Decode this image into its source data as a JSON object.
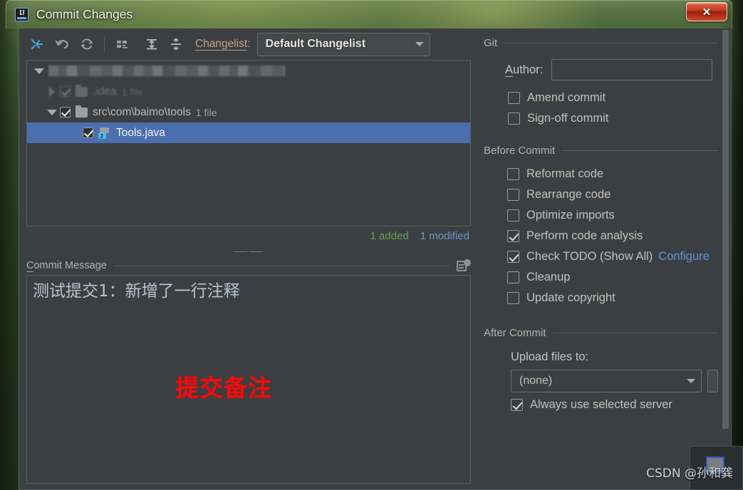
{
  "window": {
    "title": "Commit Changes",
    "app_icon": "intellij-idea-icon",
    "close_label": "✕"
  },
  "toolbar": {
    "buttons": [
      {
        "name": "show-diff-icon",
        "tooltip": "Show Diff"
      },
      {
        "name": "rollback-icon",
        "tooltip": "Rollback"
      },
      {
        "name": "refresh-icon",
        "tooltip": "Refresh"
      },
      {
        "name": "group-by-icon",
        "tooltip": "Group By"
      },
      {
        "name": "expand-all-icon",
        "tooltip": "Expand All"
      },
      {
        "name": "collapse-all-icon",
        "tooltip": "Collapse All"
      }
    ],
    "changelist_label": "Changelist:",
    "changelist_label_mnemonic": "Changelist",
    "changelist_value": "Default Changelist"
  },
  "tree": {
    "rows": [
      {
        "label": "",
        "redacted": true,
        "expanded": true,
        "checked": false,
        "count": ""
      },
      {
        "label": ".idea",
        "count": "1 file",
        "expanded": false,
        "checked": true,
        "faded": true
      },
      {
        "label": "src\\com\\baimo\\tools",
        "count": "1 file",
        "expanded": true,
        "checked": true
      },
      {
        "label": "Tools.java",
        "count": "",
        "checked": true,
        "selected": true,
        "icon": "java-file-icon"
      }
    ]
  },
  "counts": {
    "added": "1 added",
    "modified": "1 modified",
    "added_color": "#6a9a57",
    "modified_color": "#6a96c4"
  },
  "splitter": {
    "grip": "⸺⸺"
  },
  "commit_message": {
    "title": "Commit Message",
    "title_mnemonic": "C",
    "value": "测试提交1：新增了一行注释",
    "history_icon": "commit-message-history-icon"
  },
  "annotation": {
    "text": "提交备注",
    "color": "#f10c0c"
  },
  "right_panel": {
    "git_section": {
      "title": "Git",
      "author_label": "Author:",
      "author_mnemonic": "A",
      "author_value": "",
      "checkboxes": [
        {
          "label": "Amend commit",
          "checked": false,
          "mnemonic": "m"
        },
        {
          "label": "Sign-off commit",
          "checked": false,
          "mnemonic": "g"
        }
      ]
    },
    "before_commit_section": {
      "title": "Before Commit",
      "checkboxes": [
        {
          "label": "Reformat code",
          "checked": false,
          "mnemonic": "R"
        },
        {
          "label": "Rearrange code",
          "checked": false,
          "mnemonic": "n"
        },
        {
          "label": "Optimize imports",
          "checked": false,
          "mnemonic": "O"
        },
        {
          "label": "Perform code analysis",
          "checked": true,
          "mnemonic": "s"
        },
        {
          "label": "Check TODO (Show All)",
          "checked": true,
          "link": "Configure"
        },
        {
          "label": "Cleanup",
          "checked": false,
          "mnemonic": "l"
        },
        {
          "label": "Update copyright",
          "checked": false,
          "mnemonic": "U"
        }
      ],
      "configure_link": "Configure"
    },
    "after_commit_section": {
      "title": "After Commit",
      "upload_label": "Upload files to:",
      "upload_value": "(none)",
      "always_label": "Always use selected server",
      "always_checked": true
    }
  },
  "watermark": {
    "text": "CSDN @孙和龚"
  },
  "ime": {
    "name": "ime-candidate-popup"
  }
}
